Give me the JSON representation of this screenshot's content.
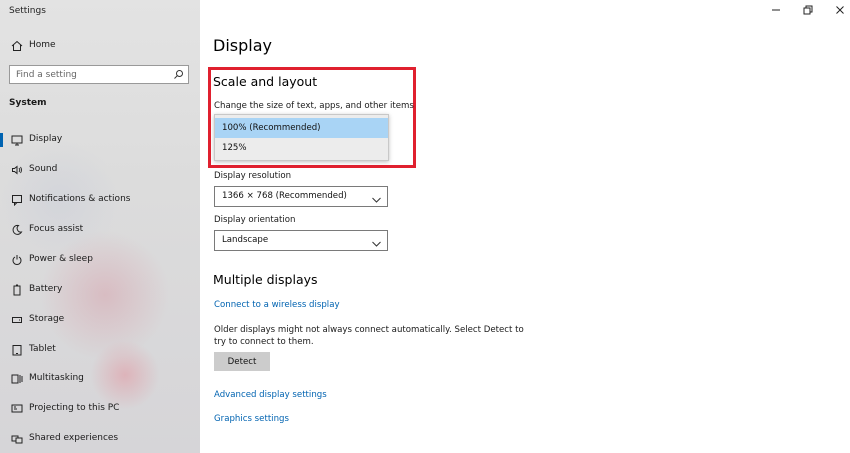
{
  "window": {
    "title": "Settings"
  },
  "sidebar": {
    "home_label": "Home",
    "search": {
      "placeholder": "Find a setting"
    },
    "section_label": "System",
    "items": [
      {
        "label": "Display",
        "icon": "monitor-icon",
        "active": true
      },
      {
        "label": "Sound",
        "icon": "speaker-icon"
      },
      {
        "label": "Notifications & actions",
        "icon": "notification-icon"
      },
      {
        "label": "Focus assist",
        "icon": "moon-icon"
      },
      {
        "label": "Power & sleep",
        "icon": "power-icon"
      },
      {
        "label": "Battery",
        "icon": "battery-icon"
      },
      {
        "label": "Storage",
        "icon": "storage-icon"
      },
      {
        "label": "Tablet",
        "icon": "tablet-icon"
      },
      {
        "label": "Multitasking",
        "icon": "multitasking-icon"
      },
      {
        "label": "Projecting to this PC",
        "icon": "projector-icon"
      },
      {
        "label": "Shared experiences",
        "icon": "shared-icon"
      }
    ]
  },
  "main": {
    "page_title": "Display",
    "scale": {
      "heading": "Scale and layout",
      "change_size_label": "Change the size of text, apps, and other items",
      "options": [
        "100% (Recommended)",
        "125%"
      ],
      "selected": "100% (Recommended)"
    },
    "resolution": {
      "label": "Display resolution",
      "value": "1366 × 768 (Recommended)"
    },
    "orientation": {
      "label": "Display orientation",
      "value": "Landscape"
    },
    "multiple": {
      "heading": "Multiple displays",
      "connect_link": "Connect to a wireless display",
      "desc_line1": "Older displays might not always connect automatically. Select Detect to",
      "desc_line2": "try to connect to them.",
      "detect_button": "Detect"
    },
    "advanced_link": "Advanced display settings",
    "graphics_link": "Graphics settings"
  },
  "colors": {
    "accent": "#0063b1",
    "highlight_border": "#e0202f",
    "selected_option": "#a9d4f5"
  }
}
